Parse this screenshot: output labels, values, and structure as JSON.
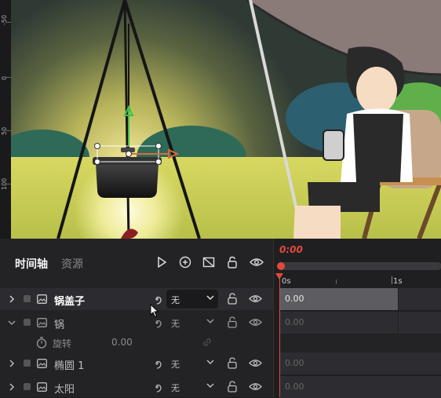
{
  "ruler": {
    "labels": [
      "-50",
      "0",
      "50",
      "100"
    ]
  },
  "panel": {
    "tabs": [
      {
        "label": "时间轴"
      },
      {
        "label": "资源"
      }
    ],
    "layers": [
      {
        "name": "锅盖子",
        "easing": "无",
        "expanded": false,
        "selected": true
      },
      {
        "name": "锅",
        "easing": "无",
        "expanded": true,
        "selected": false
      },
      {
        "property": "旋转",
        "value": "0.00"
      },
      {
        "name": "椭圆 1",
        "easing": "无",
        "expanded": false,
        "selected": false
      },
      {
        "name": "太阳",
        "easing": "无",
        "expanded": false,
        "selected": false
      }
    ]
  },
  "timeline": {
    "current_time": "0:00",
    "ticks": [
      "0s",
      "1s"
    ],
    "tracks": [
      {
        "value": "0.00",
        "selected": true
      },
      {
        "value": "0.00",
        "selected": false
      },
      {
        "value": "",
        "selected": false
      },
      {
        "value": "0.00",
        "selected": false
      },
      {
        "value": "0.00",
        "selected": false
      }
    ]
  },
  "colors": {
    "accent": "#e04a3a",
    "panel_bg": "#232326",
    "selected_track": "#5c5c61"
  }
}
